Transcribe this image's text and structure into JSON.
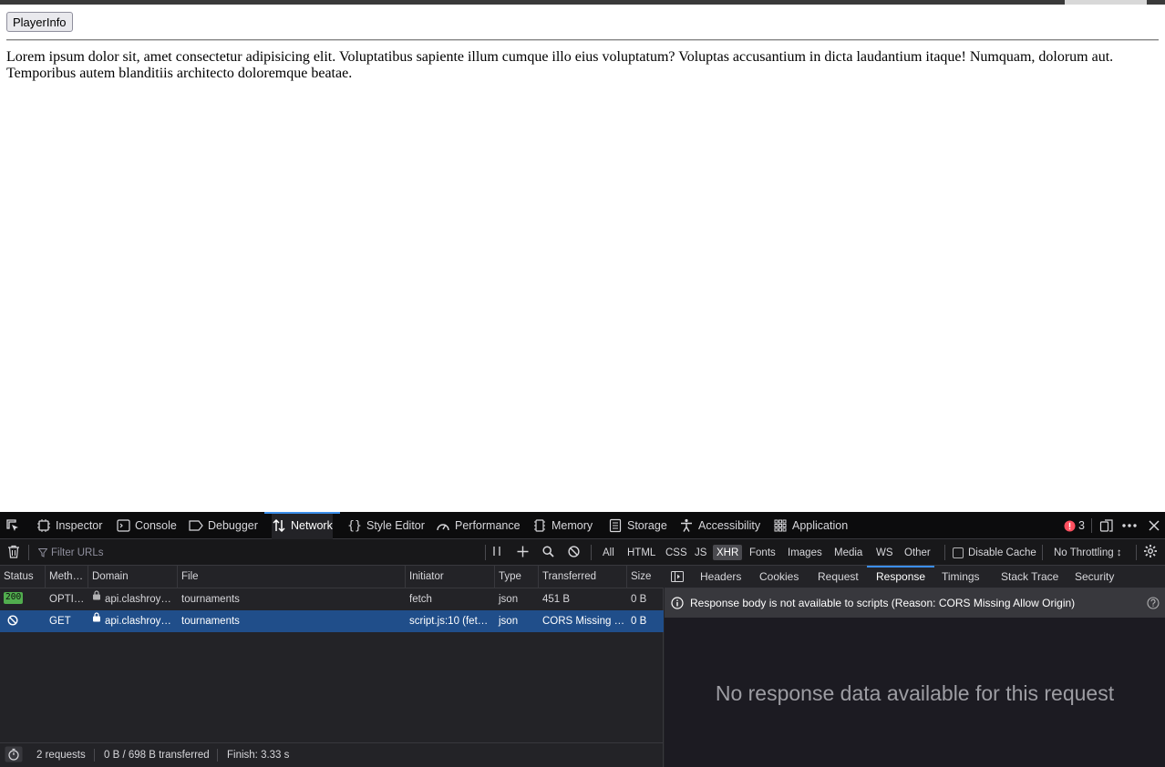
{
  "page": {
    "button_label": "PlayerInfo",
    "paragraph": "Lorem ipsum dolor sit, amet consectetur adipisicing elit. Voluptatibus sapiente illum cumque illo eius voluptatum? Voluptas accusantium in dicta laudantium itaque! Numquam, dolorum aut. Temporibus autem blanditiis architecto doloremque beatae."
  },
  "devtools": {
    "tools": [
      "Inspector",
      "Console",
      "Debugger",
      "Network",
      "Style Editor",
      "Performance",
      "Memory",
      "Storage",
      "Accessibility",
      "Application"
    ],
    "active_tool": "Network",
    "error_count": "3",
    "toolbar": {
      "filter_placeholder": "Filter URLs",
      "type_filters": [
        "All",
        "HTML",
        "CSS",
        "JS",
        "XHR",
        "Fonts",
        "Images",
        "Media",
        "WS",
        "Other"
      ],
      "active_filter": "XHR",
      "disable_cache_label": "Disable Cache",
      "throttling_label": "No Throttling ↕"
    },
    "columns": [
      "Status",
      "Meth…",
      "Domain",
      "File",
      "Initiator",
      "Type",
      "Transferred",
      "Size"
    ],
    "requests": [
      {
        "status": "200",
        "method": "OPTI…",
        "domain": "api.clashroy…",
        "file": "tournaments",
        "initiator": "fetch",
        "type": "json",
        "transferred": "451 B",
        "size": "0 B"
      },
      {
        "status": "blocked",
        "method": "GET",
        "domain": "api.clashroy…",
        "file": "tournaments",
        "initiator": "script.js:10 (fet…",
        "type": "json",
        "transferred": "CORS Missing …",
        "size": "0 B"
      }
    ],
    "detail_tabs": [
      "Headers",
      "Cookies",
      "Request",
      "Response",
      "Timings",
      "Stack Trace",
      "Security"
    ],
    "active_detail_tab": "Response",
    "notice": "Response body is not available to scripts (Reason: CORS Missing Allow Origin)",
    "empty_message": "No response data available for this request",
    "statusbar": {
      "requests": "2 requests",
      "transferred": "0 B / 698 B transferred",
      "finish": "Finish: 3.33 s"
    },
    "colors": {
      "accent": "#3b8eea",
      "status_ok": "#51ad4e",
      "selected_row": "#204e8a"
    }
  }
}
